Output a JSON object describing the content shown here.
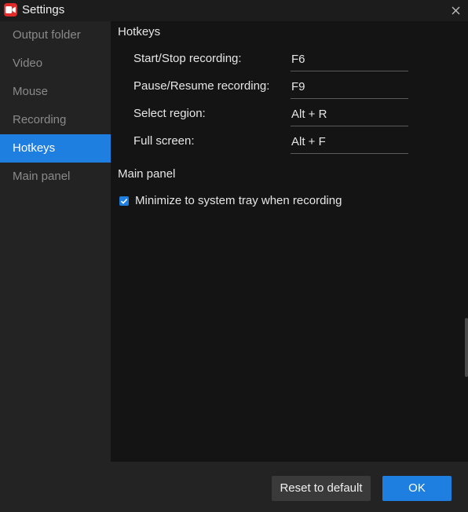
{
  "window": {
    "title": "Settings"
  },
  "sidebar": {
    "items": [
      {
        "label": "Output folder"
      },
      {
        "label": "Video"
      },
      {
        "label": "Mouse"
      },
      {
        "label": "Recording"
      },
      {
        "label": "Hotkeys"
      },
      {
        "label": "Main panel"
      }
    ],
    "active": "Hotkeys"
  },
  "hotkeys": {
    "title": "Hotkeys",
    "rows": [
      {
        "label": "Start/Stop recording:",
        "value": "F6"
      },
      {
        "label": "Pause/Resume recording:",
        "value": "F9"
      },
      {
        "label": "Select region:",
        "value": "Alt + R"
      },
      {
        "label": "Full screen:",
        "value": "Alt + F"
      }
    ]
  },
  "main_panel": {
    "title": "Main panel",
    "minimize_to_tray": {
      "label": "Minimize to system tray when recording",
      "checked": true
    }
  },
  "footer": {
    "reset_label": "Reset to default",
    "ok_label": "OK"
  },
  "colors": {
    "accent": "#1e7fe0",
    "app_icon": "#e12b2b"
  },
  "icons": [
    "camera-icon",
    "close-icon",
    "checkmark-icon"
  ]
}
